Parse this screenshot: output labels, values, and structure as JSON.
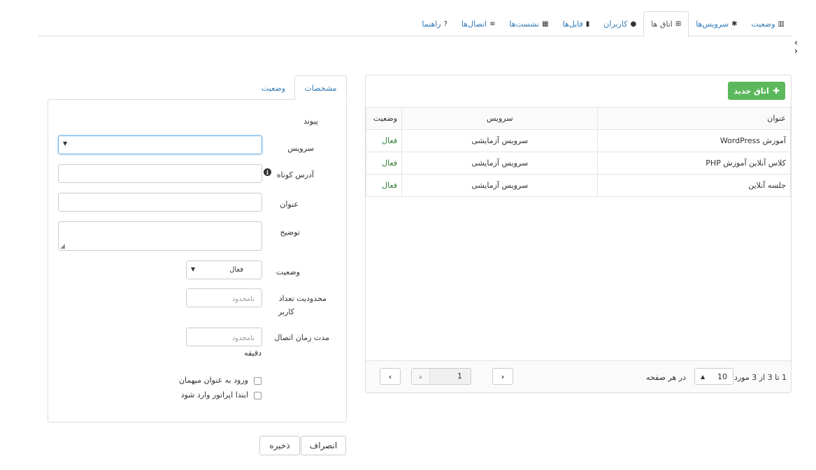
{
  "nav": {
    "tabs": [
      {
        "label": "وضعیت",
        "icon": "bar-chart-icon",
        "glyph": "▥"
      },
      {
        "label": "سرویس‌ها",
        "icon": "gear-icon",
        "glyph": "✱"
      },
      {
        "label": "اتاق ها",
        "icon": "sitemap-icon",
        "glyph": "⊞"
      },
      {
        "label": "کاربران",
        "icon": "user-icon",
        "glyph": "●"
      },
      {
        "label": "فایل‌ها",
        "icon": "file-icon",
        "glyph": "▮"
      },
      {
        "label": "نشست‌ها",
        "icon": "grid-icon",
        "glyph": "▦"
      },
      {
        "label": "اتصال‌ها",
        "icon": "list-icon",
        "glyph": "≡"
      },
      {
        "label": "راهنما",
        "icon": "question-icon",
        "glyph": "?"
      }
    ],
    "active_tab": 2
  },
  "rooms": {
    "new_button": "اتاق جدید",
    "columns": {
      "title": "عنوان",
      "service": "سرویس",
      "status": "وضعیت"
    },
    "rows": [
      {
        "title": "آموزش WordPress",
        "service": "سرویس آزمایشی",
        "status": "فعال"
      },
      {
        "title": "کلاس آنلاین آموزش PHP",
        "service": "سرویس آزمایشی",
        "status": "فعال"
      },
      {
        "title": "جلسه آنلاین",
        "service": "سرویس آزمایشی",
        "status": "فعال"
      }
    ],
    "pager": {
      "info": "1 تا 3 از 3 مورد",
      "page_size": "10",
      "per_page_label": "در هر صفحه",
      "current_page": "1"
    }
  },
  "form": {
    "tabs": {
      "details": "مشخصات",
      "status": "وضعیت"
    },
    "fields": {
      "link": "پیوند",
      "service": "سرویس",
      "short_address": "آدرس کوتاه",
      "title": "عنوان",
      "description": "توضیح",
      "status": "وضعیت",
      "status_value": "فعال",
      "user_limit_1": "محدودیت تعداد",
      "user_limit_2": "کاربر",
      "user_limit_placeholder": "نامحدود",
      "duration": "مدت زمان اتصال",
      "duration_placeholder": "نامحدود",
      "duration_unit": "دقیقه",
      "guest_login": "ورود به عنوان میهمان",
      "operator_first": "ابتدا اپراتور وارد شود"
    },
    "buttons": {
      "save": "ذخیره",
      "cancel": "انصراف"
    }
  }
}
